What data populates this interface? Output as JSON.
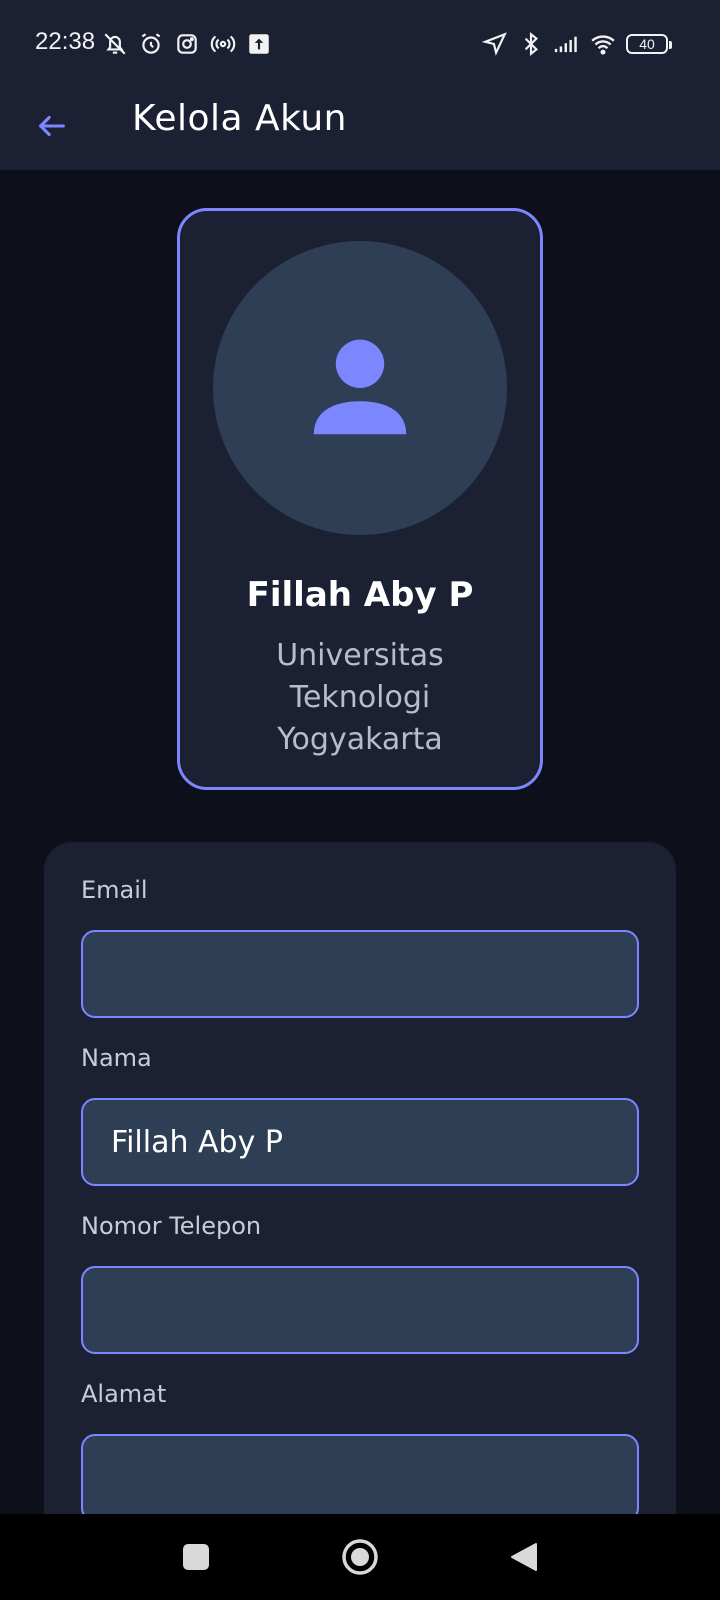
{
  "status_bar": {
    "time": "22:38",
    "battery": "40",
    "icons_left": [
      "notifications-off-icon",
      "alarm-icon",
      "instagram-icon",
      "hotspot-icon",
      "upload-icon"
    ],
    "icons_right": [
      "location-icon",
      "bluetooth-icon",
      "signal-icon",
      "wifi-icon",
      "battery-icon"
    ]
  },
  "app_bar": {
    "title": "Kelola Akun",
    "back_icon": "arrow-left-icon"
  },
  "profile": {
    "name": "Fillah Aby P",
    "organization": "Universitas Teknologi Yogyakarta",
    "avatar_icon": "person-icon"
  },
  "form": {
    "email": {
      "label": "Email",
      "value": ""
    },
    "nama": {
      "label": "Nama",
      "value": "Fillah Aby P"
    },
    "nomor_telepon": {
      "label": "Nomor Telepon",
      "value": ""
    },
    "alamat": {
      "label": "Alamat",
      "value": ""
    }
  },
  "nav_bar": {
    "buttons": [
      "recents-square-icon",
      "home-circle-icon",
      "back-triangle-icon"
    ]
  },
  "colors": {
    "accent": "#7c87ff",
    "surface": "#1b2033",
    "background": "#0d101b",
    "input_fill": "#2e3e54"
  }
}
